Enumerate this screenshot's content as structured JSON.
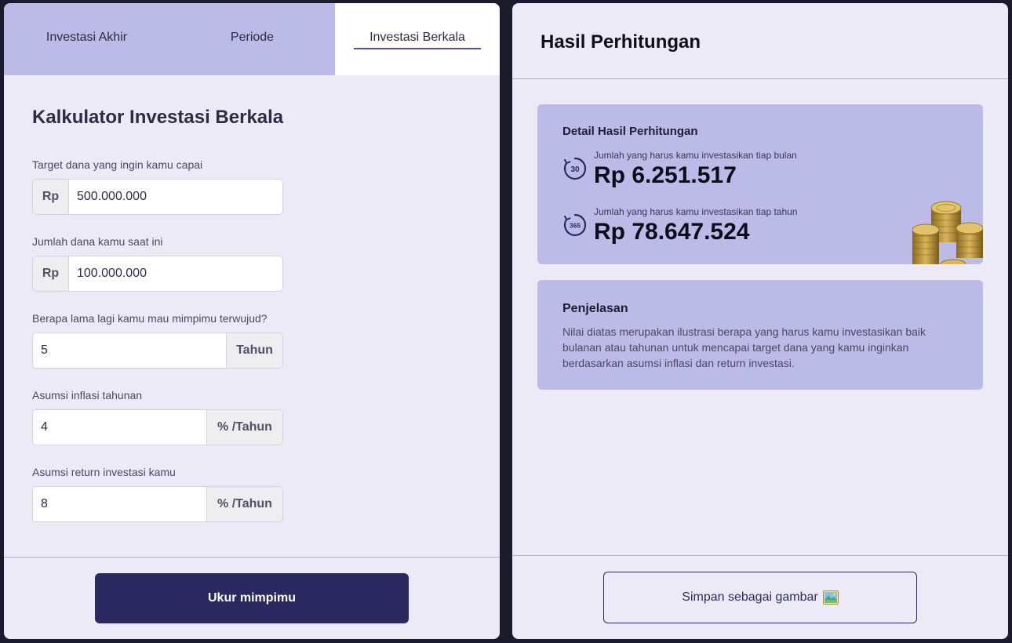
{
  "tabs": [
    {
      "label": "Investasi Akhir",
      "active": false
    },
    {
      "label": "Periode",
      "active": false
    },
    {
      "label": "Investasi Berkala",
      "active": true
    }
  ],
  "form": {
    "title": "Kalkulator Investasi Berkala",
    "fields": [
      {
        "label": "Target dana yang ingin kamu capai",
        "prefix": "Rp",
        "value": "500.000.000"
      },
      {
        "label": "Jumlah dana kamu saat ini",
        "prefix": "Rp",
        "value": "100.000.000"
      },
      {
        "label": "Berapa lama lagi kamu mau mimpimu terwujud?",
        "suffix": "Tahun",
        "value": "5"
      },
      {
        "label": "Asumsi inflasi tahunan",
        "suffix": "% /Tahun",
        "value": "4"
      },
      {
        "label": "Asumsi return investasi kamu",
        "suffix": "% /Tahun",
        "value": "8"
      }
    ],
    "submit_label": "Ukur mimpimu"
  },
  "result": {
    "title": "Hasil Perhitungan",
    "detail": {
      "heading": "Detail Hasil Perhitungan",
      "monthly": {
        "icon": "calendar-30-icon",
        "badge": "30",
        "caption": "Jumlah yang harus kamu investasikan tiap bulan",
        "value": "Rp 6.251.517"
      },
      "yearly": {
        "icon": "calendar-365-icon",
        "badge": "365",
        "caption": "Jumlah yang harus kamu investasikan tiap tahun",
        "value": "Rp 78.647.524"
      },
      "illustration": "gold-coins-icon"
    },
    "explanation": {
      "heading": "Penjelasan",
      "text": "Nilai diatas merupakan ilustrasi berapa yang harus kamu investasikan baik bulanan atau tahunan untuk mencapai target dana yang kamu inginkan berdasarkan asumsi inflasi dan return investasi."
    },
    "save_label": "Simpan sebagai gambar",
    "save_icon": "picture-icon"
  },
  "colors": {
    "background": "#1c1b2e",
    "panel": "#ebeaf6",
    "accent": "#bcbae6",
    "primary": "#2c2960",
    "tab_underline": "#4f4ab5"
  }
}
